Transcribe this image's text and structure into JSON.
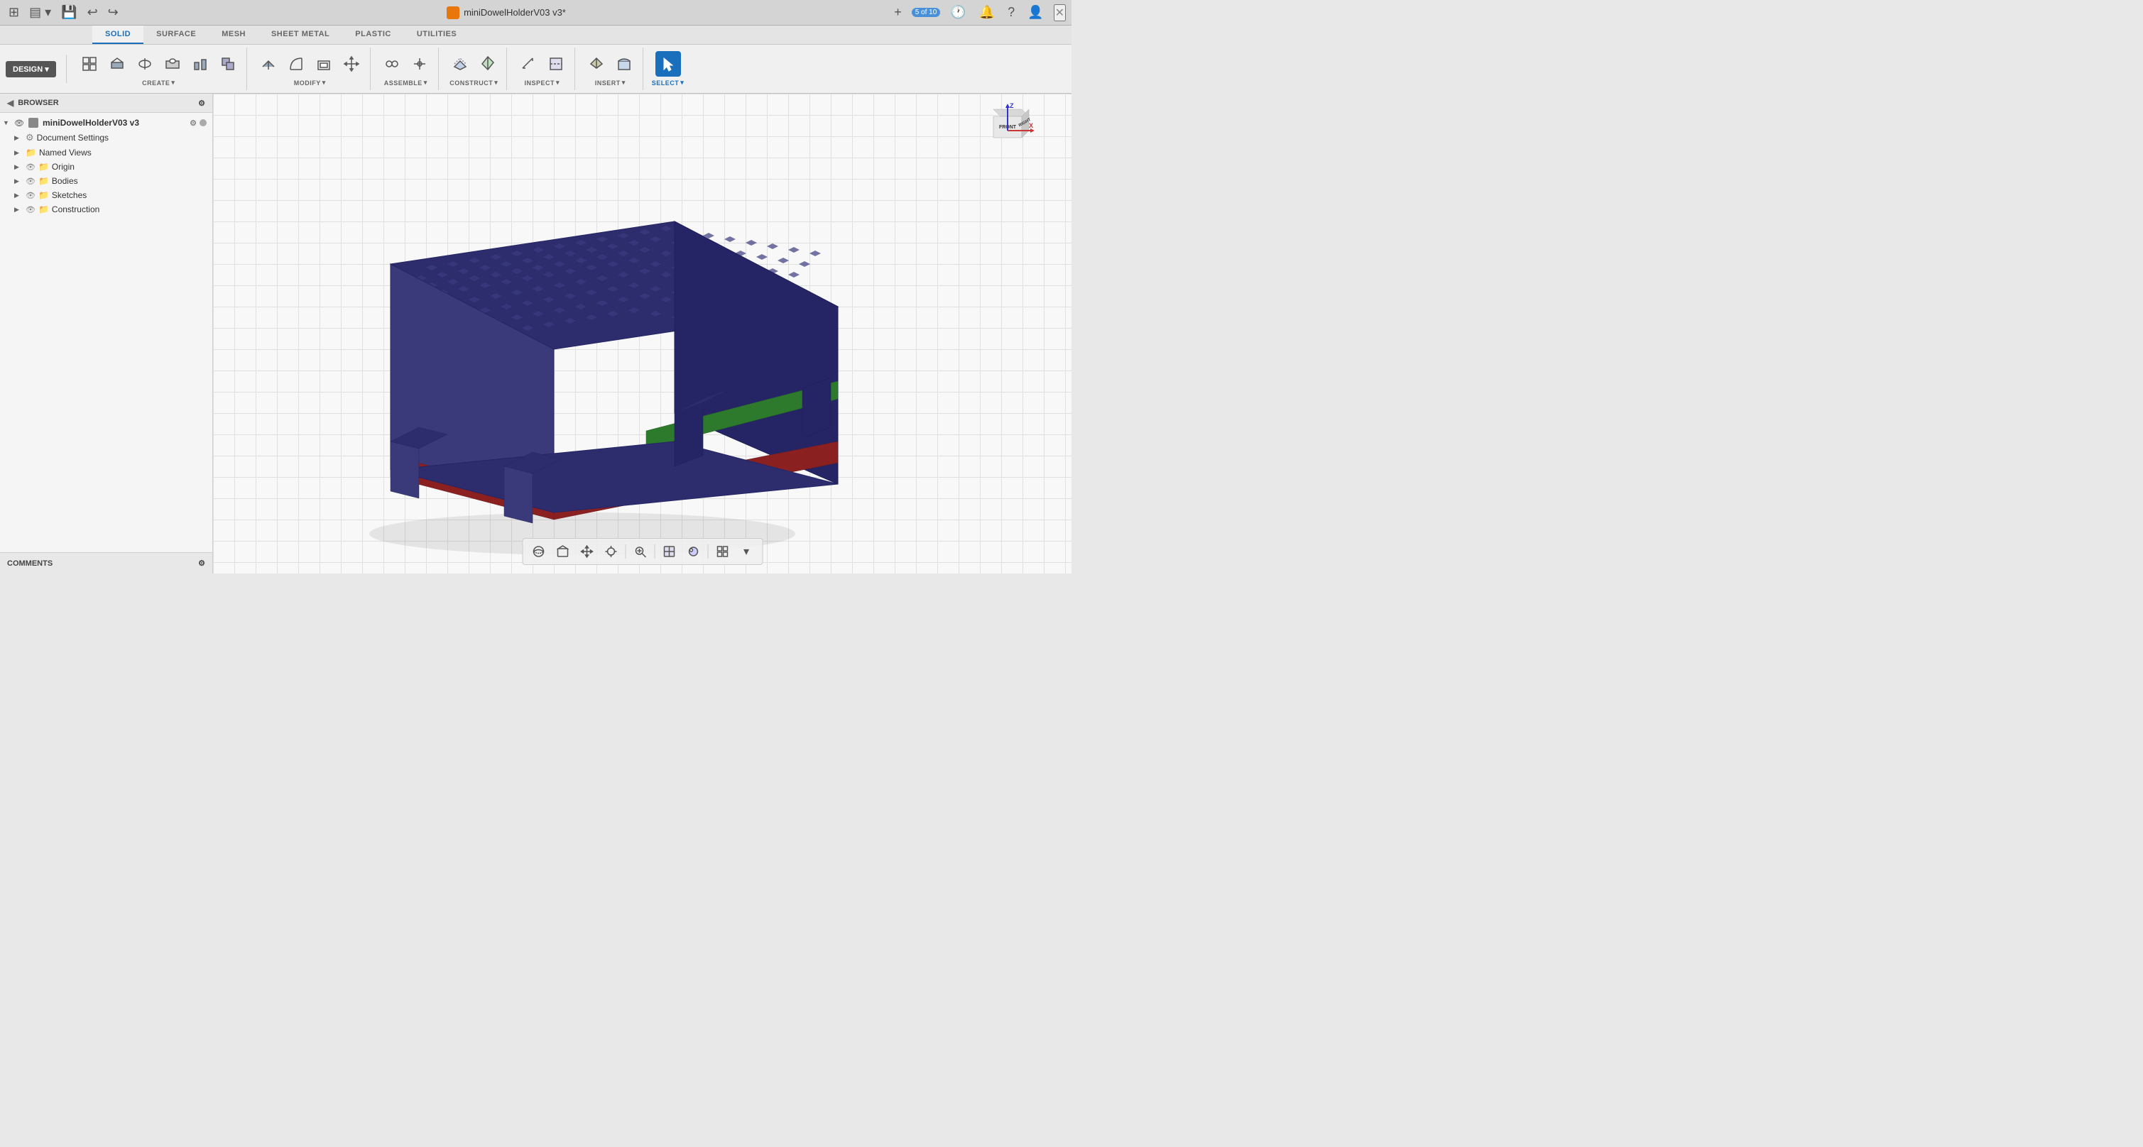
{
  "titlebar": {
    "title": "miniDowelHolderV03 v3*",
    "close_label": "×",
    "add_label": "+",
    "counter": "5 of 10"
  },
  "tabs": [
    {
      "label": "SOLID",
      "active": true
    },
    {
      "label": "SURFACE",
      "active": false
    },
    {
      "label": "MESH",
      "active": false
    },
    {
      "label": "SHEET METAL",
      "active": false
    },
    {
      "label": "PLASTIC",
      "active": false
    },
    {
      "label": "UTILITIES",
      "active": false
    }
  ],
  "design_button": "DESIGN ▾",
  "tool_groups": [
    {
      "label": "CREATE",
      "has_dropdown": true,
      "icons": [
        "box-icon",
        "extrude-icon",
        "revolve-icon",
        "hole-icon",
        "pattern-icon",
        "combine-icon",
        "mirror-icon",
        "move-icon"
      ]
    },
    {
      "label": "MODIFY",
      "has_dropdown": true,
      "icons": [
        "press-pull-icon",
        "fillet-icon",
        "chamfer-icon",
        "shell-icon",
        "draft-icon",
        "scale-icon",
        "split-body-icon",
        "replace-face-icon"
      ]
    },
    {
      "label": "ASSEMBLE",
      "has_dropdown": true,
      "icons": [
        "joint-icon",
        "joint-origin-icon"
      ]
    },
    {
      "label": "CONSTRUCT",
      "has_dropdown": true,
      "icons": [
        "offset-plane-icon",
        "plane-angle-icon"
      ]
    },
    {
      "label": "INSPECT",
      "has_dropdown": true,
      "icons": [
        "measure-icon",
        "interference-icon"
      ]
    },
    {
      "label": "INSERT",
      "has_dropdown": true,
      "icons": [
        "insert-icon",
        "decal-icon"
      ]
    },
    {
      "label": "SELECT",
      "has_dropdown": true,
      "icons": [
        "select-icon"
      ],
      "active": true
    }
  ],
  "browser": {
    "title": "BROWSER",
    "collapse_icon": "◀",
    "settings_icon": "⚙"
  },
  "tree": [
    {
      "level": "root",
      "name": "miniDowelHolderV03 v3",
      "has_chevron": true,
      "has_eye": true,
      "has_gear": true,
      "has_dot": true
    },
    {
      "level": "level1",
      "name": "Document Settings",
      "has_chevron": true,
      "has_gear": true
    },
    {
      "level": "level1",
      "name": "Named Views",
      "has_chevron": true,
      "has_folder": true
    },
    {
      "level": "level1",
      "name": "Origin",
      "has_chevron": true,
      "has_eye": true,
      "has_folder": true
    },
    {
      "level": "level1",
      "name": "Bodies",
      "has_chevron": true,
      "has_eye": true,
      "has_folder": true
    },
    {
      "level": "level1",
      "name": "Sketches",
      "has_chevron": true,
      "has_eye": true,
      "has_folder": true
    },
    {
      "level": "level1",
      "name": "Construction",
      "has_chevron": true,
      "has_eye": true,
      "has_folder": true
    }
  ],
  "comments": {
    "label": "COMMENTS",
    "settings_icon": "⚙"
  },
  "bottom_toolbar": {
    "tools": [
      "orbit-icon",
      "pan-icon",
      "fit-icon",
      "zoom-icon",
      "display-icon",
      "appearance-icon",
      "grid-icon"
    ]
  },
  "axis": {
    "z_label": "Z",
    "x_label": "X",
    "front_label": "FRONT",
    "right_label": "RIGHT"
  }
}
